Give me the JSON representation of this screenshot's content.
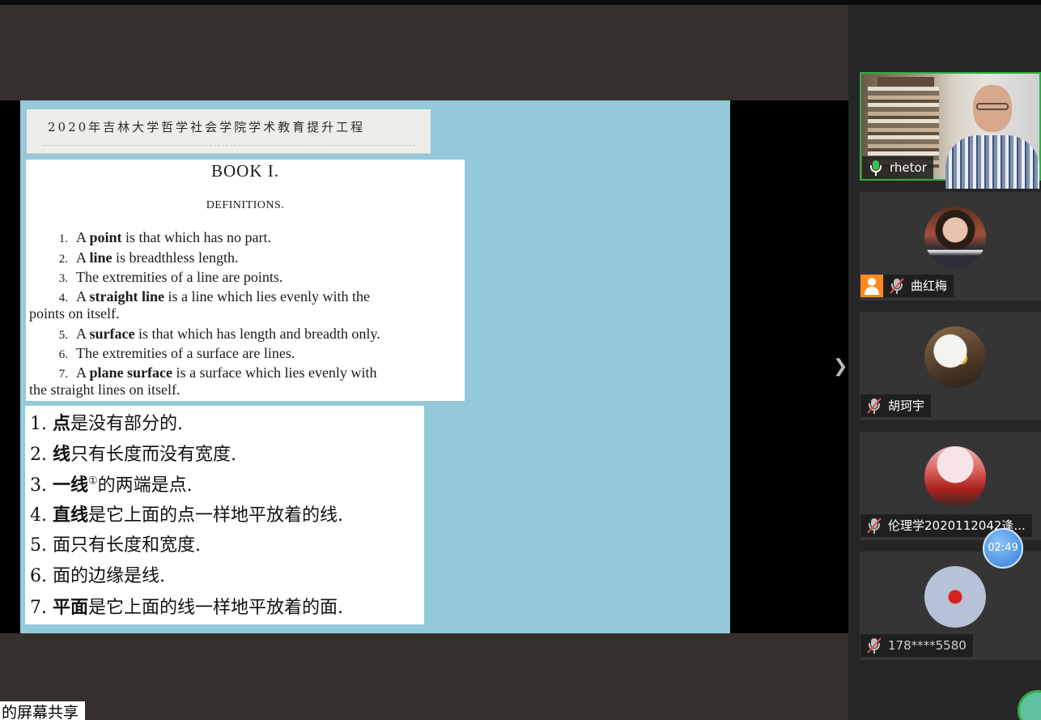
{
  "banner": {
    "text": "2020年吉林大学哲学社会学院学术教育提升工程"
  },
  "english": {
    "title": "BOOK I.",
    "subtitle": "DEFINITIONS.",
    "items": [
      {
        "num": "1.",
        "pre": "A ",
        "bold": "point",
        "post": " is that which has no part."
      },
      {
        "num": "2.",
        "pre": "A ",
        "bold": "line",
        "post": " is breadthless length."
      },
      {
        "num": "3.",
        "pre": "The extremities of a line are points.",
        "bold": "",
        "post": ""
      },
      {
        "num": "4.",
        "pre": "A ",
        "bold": "straight line",
        "post": " is a line which lies evenly with the",
        "cont": "points on itself."
      },
      {
        "num": "5.",
        "pre": "A ",
        "bold": "surface",
        "post": " is that which has length and breadth only."
      },
      {
        "num": "6.",
        "pre": "The extremities of a surface are lines.",
        "bold": "",
        "post": ""
      },
      {
        "num": "7.",
        "pre": "A ",
        "bold": "plane surface",
        "post": " is a surface which lies evenly with",
        "cont": "the straight lines on itself."
      }
    ]
  },
  "chinese": {
    "items": [
      {
        "num": "1.",
        "bold": "点",
        "post": "是没有部分的."
      },
      {
        "num": "2.",
        "bold": "线",
        "post": "只有长度而没有宽度."
      },
      {
        "num": "3.",
        "bold": "一线",
        "sup": "①",
        "post": "的两端是点."
      },
      {
        "num": "4.",
        "bold": "直线",
        "post": "是它上面的点一样地平放着的线."
      },
      {
        "num": "5.",
        "bold": "",
        "post": "面只有长度和宽度."
      },
      {
        "num": "6.",
        "bold": "",
        "post": "面的边缘是线."
      },
      {
        "num": "7.",
        "bold": "平面",
        "post": "是它上面的线一样地平放着的面."
      }
    ]
  },
  "participants": [
    {
      "name": "rhetor",
      "mic": "on",
      "type": "video"
    },
    {
      "name": "曲红梅",
      "mic": "muted",
      "host": true
    },
    {
      "name": "胡珂宇",
      "mic": "muted"
    },
    {
      "name": "伦理学2020112042逢...",
      "mic": "muted"
    },
    {
      "name": "178****5580",
      "mic": "muted"
    }
  ],
  "timer": "02:49",
  "share_label": "的屏幕共享",
  "icons": {
    "next": "chevron-right-icon",
    "mic": "microphone-icon",
    "host": "host-user-icon"
  },
  "colors": {
    "slide_bg": "#93c9d9",
    "speaking_border": "#2fae43",
    "host_badge": "#ff8a1f",
    "timer": "#4b93e0"
  }
}
